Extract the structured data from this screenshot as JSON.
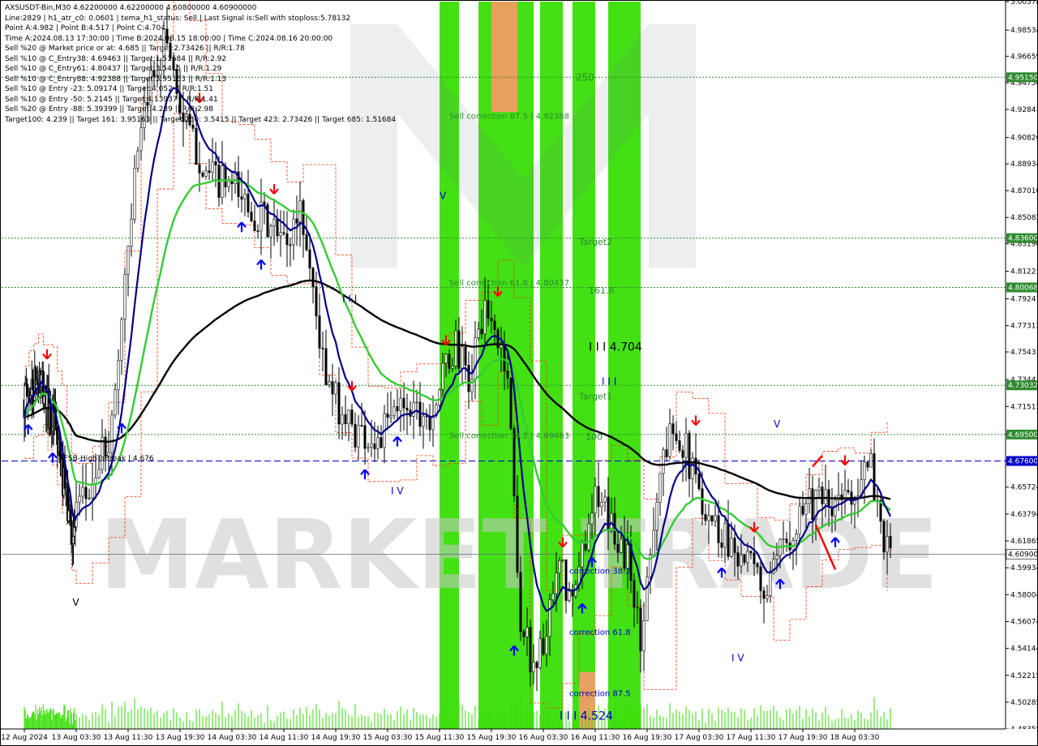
{
  "info": {
    "lines": [
      "AXSUSDT-Bin,M30  4.62200000 4.62200000 4.60800000 4.60900000",
      "Line:2829 | h1_atr_c0: 0.0601 | tema_h1_status: Sell | Last Signal is:Sell with stoploss:5.78132",
      "Point A:4.982 | Point B:4.517 | Point C:4.704",
      "Time A:2024.08.13 17:30:00 | Time B:2024.08.15 18:00:00 | Time C:2024.08.16 20:00:00",
      "Sell %20 @ Market price or at: 4.685 || Target:2.73426 || R/R:1.78",
      "Sell %10 @ C_Entry38: 4.69463 || Target:1.51684 || R/R:2.92",
      "Sell %10 @ C_Entry61: 4.80437 || Target:3.5415 || R/R:1.29",
      "Sell %10 @ C_Entry88: 4.92388 || Target:3.95163 || R/R:1.13",
      "Sell %10 @ Entry -23: 5.09174 || Target:4.052 || R/R:1.51",
      "Sell %10 @ Entry -50: 5.2145 || Target:4.13937 || R/R:1.41",
      "Sell %20 @ Entry -88: 5.39399 || Target:4.239 || R/R:2.98",
      "Target100: 4.239 || Target 161: 3.95163 || Target 250: 3.5415 || Target 423: 2.73426 || Target 685: 1.51684"
    ]
  },
  "watermark": "MARKET TRADE",
  "colors": {
    "bg": "#ffffff",
    "zone_green": "#33dd00",
    "zone_orange": "#e8a060",
    "bull": "#000000",
    "bear": "#000000",
    "ma_navy": "#00008b",
    "ma_green": "#33cc33",
    "ma_black": "#000000",
    "hline_green": "#2e8b2e",
    "hline_blue": "#0000cc",
    "hline_gray": "#5a6b80",
    "red_dash": "#ff3300",
    "arrow_up": "#0000ff",
    "arrow_down": "#ff0000",
    "label_green": "#2e8b2e",
    "label_blue": "#0000cc",
    "label_black": "#000000",
    "volume": "#33dd00"
  },
  "chart_data": {
    "type": "candlestick",
    "symbol": "AXSUSDT-Bin",
    "timeframe": "M30",
    "ylim": [
      4.4836,
      5.0058
    ],
    "y_ticks": [
      "5.00578",
      "4.98534",
      "4.96659",
      "4.94750",
      "4.92841",
      "4.90826",
      "4.88934",
      "4.87010",
      "4.85083",
      "4.83190",
      "4.81221",
      "4.79241",
      "4.77313",
      "4.75431",
      "4.73443",
      "4.71513",
      "4.69544",
      "4.67621",
      "4.65724",
      "4.63794",
      "4.61865",
      "4.59934",
      "4.58004",
      "4.56074",
      "4.54144",
      "4.52215",
      "4.50285",
      "4.48355"
    ],
    "x_labels": [
      "12 Aug 2024",
      "13 Aug 03:30",
      "13 Aug 11:30",
      "13 Aug 19:30",
      "14 Aug 03:30",
      "14 Aug 11:30",
      "14 Aug 19:30",
      "15 Aug 03:30",
      "15 Aug 11:30",
      "15 Aug 19:30",
      "16 Aug 03:30",
      "16 Aug 11:30",
      "16 Aug 19:30",
      "17 Aug 03:30",
      "17 Aug 11:30",
      "17 Aug 19:30",
      "18 Aug 03:30"
    ],
    "levels": [
      {
        "value": 4.9515,
        "label": "4.95150",
        "style": "green"
      },
      {
        "value": 4.836,
        "label": "4.83600",
        "style": "green"
      },
      {
        "value": 4.8006,
        "label": "4.80068",
        "style": "green"
      },
      {
        "value": 4.7303,
        "label": "4.73032",
        "style": "green"
      },
      {
        "value": 4.695,
        "label": "4.69500",
        "style": "green"
      },
      {
        "value": 4.676,
        "label": "4.67600",
        "style": "blue"
      },
      {
        "value": 4.609,
        "label": "4.60900",
        "style": "gray"
      }
    ],
    "zones": [
      {
        "from": "15 Aug 11:30",
        "to": "15 Aug 14:30",
        "color": "green"
      },
      {
        "from": "15 Aug 17:30",
        "to": "16 Aug 02:00",
        "color": "green"
      },
      {
        "from": "15 Aug 19:30",
        "to": "15 Aug 23:30",
        "color": "orange",
        "y_top": 5.0058,
        "y_bottom": 4.9265
      },
      {
        "from": "16 Aug 03:00",
        "to": "16 Aug 06:30",
        "color": "green"
      },
      {
        "from": "16 Aug 08:00",
        "to": "16 Aug 11:30",
        "color": "green"
      },
      {
        "from": "16 Aug 09:00",
        "to": "16 Aug 11:30",
        "color": "orange",
        "y_top": 4.5245,
        "y_bottom": 4.4836
      },
      {
        "from": "16 Aug 13:30",
        "to": "16 Aug 18:30",
        "color": "green"
      }
    ],
    "annotations": [
      {
        "text": "250",
        "x": "16 Aug 08:30",
        "y": 4.9515,
        "color": "green",
        "size": 12
      },
      {
        "text": "Sell correction 87.5 | 4.92388",
        "x": "15 Aug 13:00",
        "y": 4.9239,
        "color": "green",
        "size": 10
      },
      {
        "text": "Target2",
        "x": "16 Aug 09:00",
        "y": 4.8335,
        "color": "green",
        "size": 11
      },
      {
        "text": "Sell correction 61.8 | 4.80437",
        "x": "15 Aug 13:00",
        "y": 4.8044,
        "color": "green",
        "size": 10
      },
      {
        "text": "161.8",
        "x": "16 Aug 10:30",
        "y": 4.7985,
        "color": "green",
        "size": 11
      },
      {
        "text": "I I I 4.704",
        "x": "16 Aug 10:30",
        "y": 4.7575,
        "color": "black",
        "size": 14
      },
      {
        "text": "I I I",
        "x": "16 Aug 12:30",
        "y": 4.733,
        "color": "blue",
        "size": 12
      },
      {
        "text": "Target1",
        "x": "16 Aug 09:00",
        "y": 4.7225,
        "color": "green",
        "size": 11
      },
      {
        "text": "Sell correction 38.2 | 4.69463",
        "x": "15 Aug 13:00",
        "y": 4.6946,
        "color": "green",
        "size": 10
      },
      {
        "text": "100",
        "x": "16 Aug 10:00",
        "y": 4.6935,
        "color": "green",
        "size": 11
      },
      {
        "text": "FSB-HighToBreak | 4.676",
        "x": "12 Aug 21:00",
        "y": 4.6785,
        "color": "black",
        "size": 9
      },
      {
        "text": "V",
        "x": "15 Aug 11:30",
        "y": 4.8665,
        "color": "blue",
        "size": 12
      },
      {
        "text": "I I I",
        "x": "14 Aug 20:30",
        "y": 4.7925,
        "color": "blue",
        "size": 12
      },
      {
        "text": "I V",
        "x": "15 Aug 04:00",
        "y": 4.6545,
        "color": "blue",
        "size": 12
      },
      {
        "text": "V",
        "x": "13 Aug 01:30",
        "y": 4.5745,
        "color": "black",
        "size": 12
      },
      {
        "text": "V",
        "x": "17 Aug 15:00",
        "y": 4.7025,
        "color": "blue",
        "size": 12
      },
      {
        "text": "I V",
        "x": "17 Aug 08:30",
        "y": 4.5345,
        "color": "blue",
        "size": 12
      },
      {
        "text": "correction 38.2",
        "x": "16 Aug 07:30",
        "y": 4.5975,
        "color": "blue",
        "size": 10
      },
      {
        "text": "correction 61.8",
        "x": "16 Aug 07:30",
        "y": 4.5535,
        "color": "blue",
        "size": 10
      },
      {
        "text": "correction 87.5",
        "x": "16 Aug 07:30",
        "y": 4.5095,
        "color": "blue",
        "size": 10
      },
      {
        "text": "I I I 4.524",
        "x": "16 Aug 06:00",
        "y": 4.4925,
        "color": "blue",
        "size": 14
      }
    ]
  }
}
